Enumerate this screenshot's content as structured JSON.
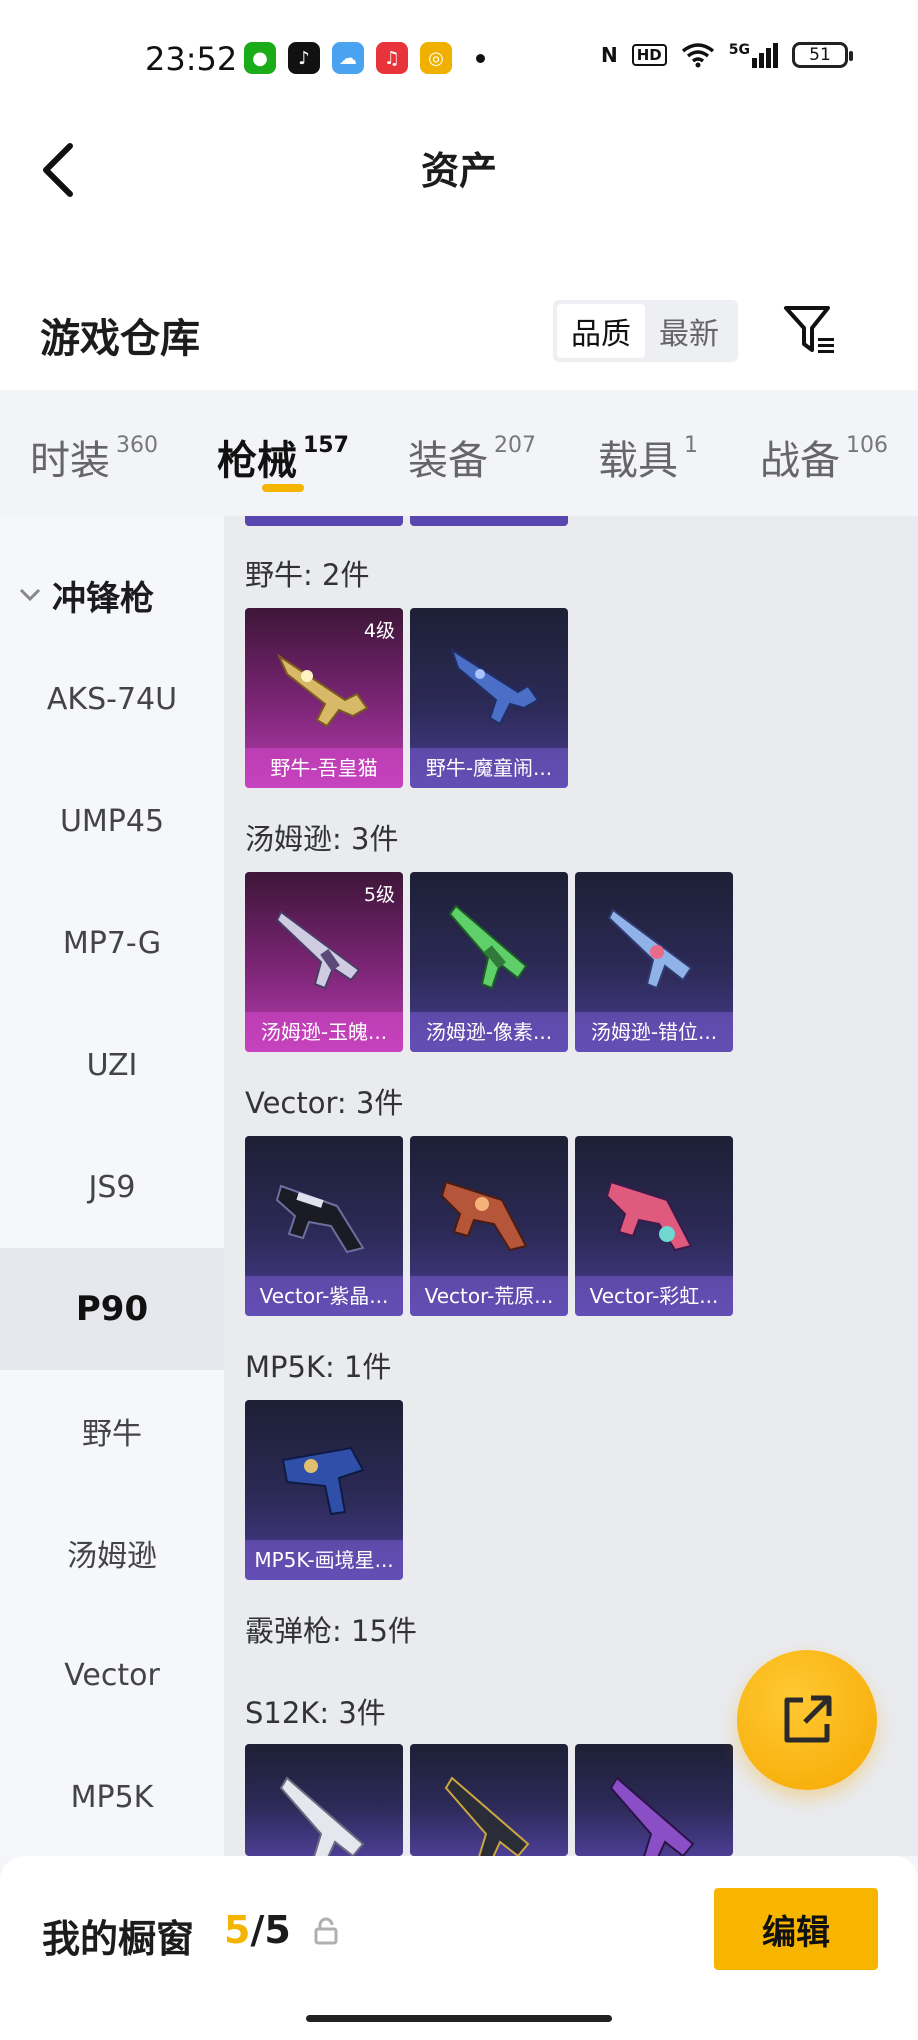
{
  "status_bar": {
    "time": "23:52",
    "battery": "51",
    "signal": "5G"
  },
  "header": {
    "title": "资产"
  },
  "section": {
    "title": "游戏仓库",
    "sort_options": [
      {
        "label": "品质",
        "active": true
      },
      {
        "label": "最新",
        "active": false
      }
    ]
  },
  "tabs": [
    {
      "label": "时装",
      "count": "360"
    },
    {
      "label": "枪械",
      "count": "157",
      "active": true
    },
    {
      "label": "装备",
      "count": "207"
    },
    {
      "label": "载具",
      "count": "1"
    },
    {
      "label": "战备",
      "count": "106"
    }
  ],
  "sidebar": {
    "group": "冲锋枪",
    "items": [
      "AKS-74U",
      "UMP45",
      "MP7-G",
      "UZI",
      "JS9",
      "P90",
      "野牛",
      "汤姆逊",
      "Vector",
      "MP5K"
    ],
    "active_item": "P90"
  },
  "groups": [
    {
      "label": "野牛: 2件",
      "items": [
        {
          "name": "野牛-吾皇猫",
          "level": "4级",
          "rarity": "pink"
        },
        {
          "name": "野牛-魔童闹...",
          "rarity": "purple"
        }
      ]
    },
    {
      "label": "汤姆逊: 3件",
      "items": [
        {
          "name": "汤姆逊-玉魄...",
          "level": "5级",
          "rarity": "pink"
        },
        {
          "name": "汤姆逊-像素...",
          "rarity": "purple"
        },
        {
          "name": "汤姆逊-错位...",
          "rarity": "purple"
        }
      ]
    },
    {
      "label": "Vector: 3件",
      "items": [
        {
          "name": "Vector-紫晶...",
          "rarity": "purple"
        },
        {
          "name": "Vector-荒原...",
          "rarity": "purple"
        },
        {
          "name": "Vector-彩虹...",
          "rarity": "purple"
        }
      ]
    },
    {
      "label": "MP5K: 1件",
      "items": [
        {
          "name": "MP5K-画境星...",
          "rarity": "purple"
        }
      ]
    },
    {
      "label": "霰弹枪: 15件"
    },
    {
      "label": "S12K: 3件"
    }
  ],
  "bottom_bar": {
    "title": "我的橱窗",
    "count_current": "5",
    "count_total": "/5",
    "edit_label": "编辑"
  },
  "colors": {
    "accent": "#f5b400",
    "purple_card": "#4c3e94",
    "pink_card": "#b53db0"
  }
}
